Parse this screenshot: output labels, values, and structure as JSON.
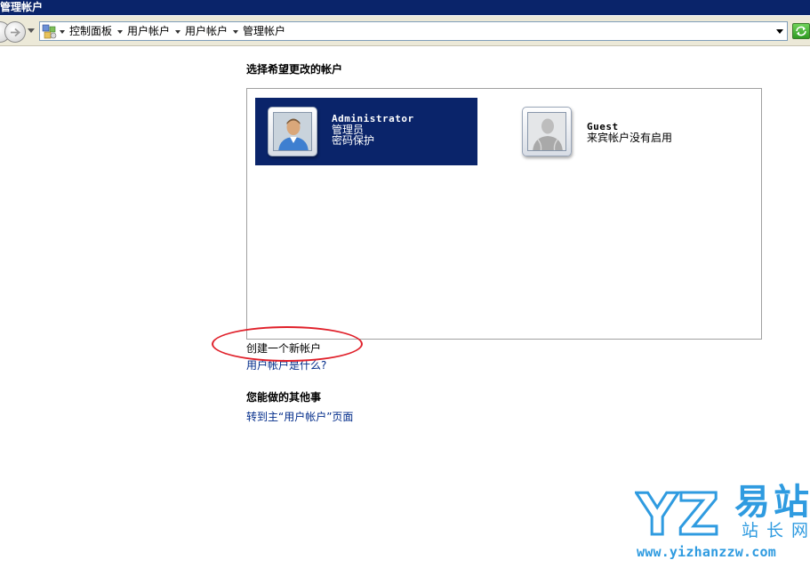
{
  "window": {
    "title": "管理帐户"
  },
  "address_bar": {
    "breadcrumbs": [
      {
        "label": "控制面板"
      },
      {
        "label": "用户帐户"
      },
      {
        "label": "用户帐户"
      },
      {
        "label": "管理帐户"
      }
    ],
    "icons": {
      "back": "back-arrow-icon",
      "forward": "forward-arrow-icon",
      "location": "control-panel-icon",
      "go": "refresh-go-icon"
    }
  },
  "main": {
    "heading": "选择希望更改的帐户",
    "accounts": [
      {
        "name": "Administrator",
        "line1": "管理员",
        "line2": "密码保护",
        "selected": true,
        "icon": "admin-user-icon"
      },
      {
        "name": "Guest",
        "line1": "来宾帐户没有启用",
        "line2": "",
        "selected": false,
        "icon": "guest-user-icon"
      }
    ],
    "links": {
      "create": "创建一个新帐户",
      "what": "用户帐户是什么?"
    },
    "other_heading": "您能做的其他事",
    "goto_link": "转到主“用户帐户”页面"
  },
  "watermark": {
    "logo": "YZ",
    "cn_top": "易站",
    "cn_bottom": "站长网",
    "url": "www.yizhanzzw.com"
  },
  "colors": {
    "title_bar": "#0a246a",
    "selected_tile": "#0a246a",
    "annotation": "#e0202a",
    "watermark": "#2f9be0",
    "link": "#002b8a"
  }
}
